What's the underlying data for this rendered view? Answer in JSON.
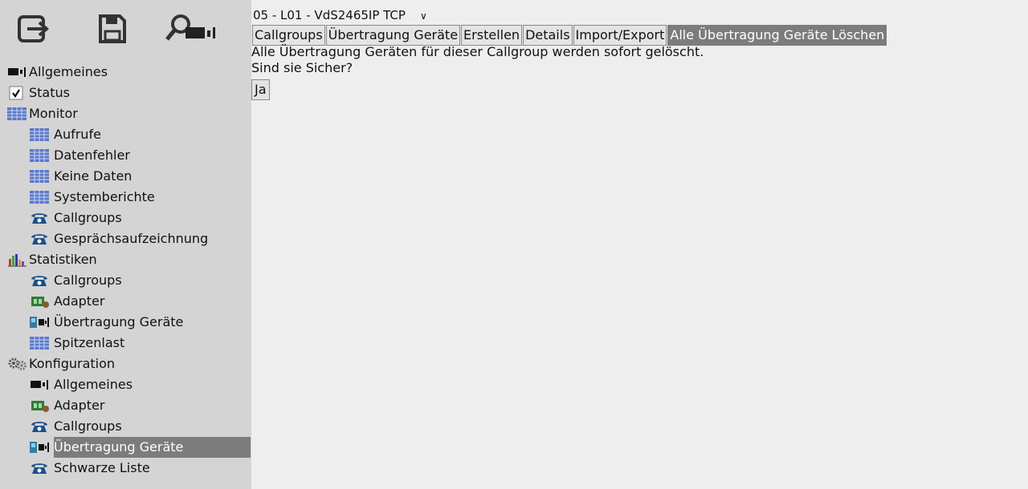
{
  "toolbar": {
    "items": [
      {
        "icon": "logout-icon"
      },
      {
        "icon": "save-icon"
      },
      {
        "icon": "search-icon"
      }
    ]
  },
  "nav": {
    "items": [
      {
        "label": "Allgemeines",
        "icon": "device-icon",
        "level": 0
      },
      {
        "label": "Status",
        "icon": "checkbox-icon",
        "level": 0
      },
      {
        "label": "Monitor",
        "icon": "grid-icon",
        "level": 0
      },
      {
        "label": "Aufrufe",
        "icon": "grid-icon",
        "level": 1
      },
      {
        "label": "Datenfehler",
        "icon": "grid-icon",
        "level": 1
      },
      {
        "label": "Keine Daten",
        "icon": "grid-icon",
        "level": 1
      },
      {
        "label": "Systemberichte",
        "icon": "grid-icon",
        "level": 1
      },
      {
        "label": "Callgroups",
        "icon": "phone-icon",
        "level": 1
      },
      {
        "label": "Gesprächsaufzeichnung",
        "icon": "phone-icon",
        "level": 1
      },
      {
        "label": "Statistiken",
        "icon": "bar-chart-icon",
        "level": 0
      },
      {
        "label": "Callgroups",
        "icon": "phone-icon",
        "level": 1
      },
      {
        "label": "Adapter",
        "icon": "adapter-icon",
        "level": 1
      },
      {
        "label": "Übertragung Geräte",
        "icon": "transfer-device-icon",
        "level": 1
      },
      {
        "label": "Spitzenlast",
        "icon": "grid-icon",
        "level": 1
      },
      {
        "label": "Konfiguration",
        "icon": "gears-icon",
        "level": 0
      },
      {
        "label": "Allgemeines",
        "icon": "device-icon",
        "level": 1
      },
      {
        "label": "Adapter",
        "icon": "adapter-icon",
        "level": 1
      },
      {
        "label": "Callgroups",
        "icon": "phone-icon",
        "level": 1
      },
      {
        "label": "Übertragung Geräte",
        "icon": "transfer-device-icon",
        "level": 1,
        "selected": true
      },
      {
        "label": "Schwarze Liste",
        "icon": "phone-icon",
        "level": 1
      }
    ]
  },
  "main": {
    "device_select": "05 - L01 - VdS2465IP TCP",
    "tabs": [
      {
        "label": "Callgroups"
      },
      {
        "label": "Übertragung Geräte"
      },
      {
        "label": "Erstellen"
      },
      {
        "label": "Details"
      },
      {
        "label": "Import/Export"
      },
      {
        "label": "Alle Übertragung Geräte Löschen",
        "active": true
      }
    ],
    "message_line1": "Alle Übertragung Geräten für dieser Callgroup werden sofort gelöscht.",
    "message_line2": "Sind sie Sicher?",
    "yes_button": "Ja"
  },
  "colors": {
    "sidebar_bg": "#d4d4d4",
    "main_bg": "#eeeeee",
    "active_bg": "#7c7c7c"
  }
}
